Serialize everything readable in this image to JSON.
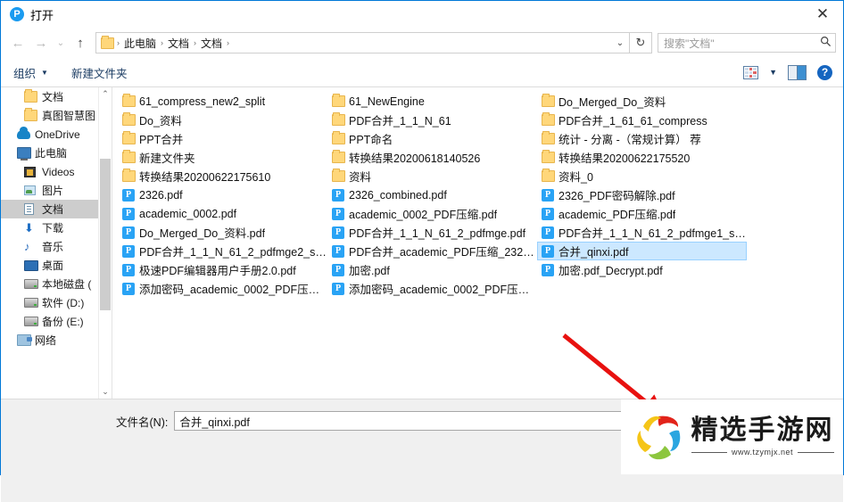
{
  "window": {
    "title": "打开",
    "app_icon": "pdf-app-icon",
    "app_icon_letter": "P",
    "close_label": "✕",
    "border_color": "#0078d7"
  },
  "nav": {
    "back_label": "←",
    "forward_label": "→",
    "history_label": "⌄",
    "up_label": "↑",
    "breadcrumb": [
      "此电脑",
      "文档",
      "文档"
    ],
    "breadcrumb_separator": "›",
    "dropdown_label": "⌄",
    "refresh_label": "↻"
  },
  "search": {
    "placeholder": "搜索\"文档\"",
    "icon": "search-icon"
  },
  "commandbar": {
    "organize_label": "组织",
    "organize_caret": "▼",
    "new_folder_label": "新建文件夹",
    "view_caret": "▼",
    "help_label": "?"
  },
  "sidebar": {
    "items": [
      {
        "label": "文档",
        "icon": "folder-icon",
        "indent": true,
        "selected": false
      },
      {
        "label": "真图智慧图",
        "icon": "folder-icon",
        "indent": true,
        "selected": false
      },
      {
        "label": "OneDrive",
        "icon": "cloud-icon",
        "indent": false,
        "selected": false
      },
      {
        "label": "此电脑",
        "icon": "computer-icon",
        "indent": false,
        "selected": false
      },
      {
        "label": "Videos",
        "icon": "video-icon",
        "indent": true,
        "selected": false
      },
      {
        "label": "图片",
        "icon": "pictures-icon",
        "indent": true,
        "selected": false
      },
      {
        "label": "文档",
        "icon": "documents-icon",
        "indent": true,
        "selected": true
      },
      {
        "label": "下载",
        "icon": "download-icon",
        "indent": true,
        "selected": false
      },
      {
        "label": "音乐",
        "icon": "music-icon",
        "indent": true,
        "selected": false
      },
      {
        "label": "桌面",
        "icon": "desktop-icon",
        "indent": true,
        "selected": false
      },
      {
        "label": "本地磁盘 (",
        "icon": "disk-icon",
        "indent": true,
        "selected": false
      },
      {
        "label": "软件 (D:)",
        "icon": "disk-icon",
        "indent": true,
        "selected": false
      },
      {
        "label": "备份 (E:)",
        "icon": "disk-icon",
        "indent": true,
        "selected": false
      },
      {
        "label": "网络",
        "icon": "network-icon",
        "indent": false,
        "selected": false
      }
    ],
    "scroll_up": "⌃",
    "scroll_down": "⌄"
  },
  "filelist": {
    "columns": [
      [
        {
          "name": "61_compress_new2_split",
          "type": "folder",
          "selected": false
        },
        {
          "name": "Do_资料",
          "type": "folder",
          "selected": false
        },
        {
          "name": "PPT合并",
          "type": "folder",
          "selected": false
        },
        {
          "name": "新建文件夹",
          "type": "folder",
          "selected": false
        },
        {
          "name": "转换结果20200622175610",
          "type": "folder",
          "selected": false
        },
        {
          "name": "2326.pdf",
          "type": "pdf",
          "selected": false
        },
        {
          "name": "academic_0002.pdf",
          "type": "pdf",
          "selected": false
        },
        {
          "name": "Do_Merged_Do_资料.pdf",
          "type": "pdf",
          "selected": false
        },
        {
          "name": "PDF合并_1_1_N_61_2_pdfmge2_sp...",
          "type": "pdf",
          "selected": false
        },
        {
          "name": "极速PDF编辑器用户手册2.0.pdf",
          "type": "pdf",
          "selected": false
        },
        {
          "name": "添加密码_academic_0002_PDF压缩...",
          "type": "pdf",
          "selected": false
        }
      ],
      [
        {
          "name": "61_NewEngine",
          "type": "folder",
          "selected": false
        },
        {
          "name": "PDF合并_1_1_N_61",
          "type": "folder",
          "selected": false
        },
        {
          "name": "PPT命名",
          "type": "folder",
          "selected": false
        },
        {
          "name": "转换结果20200618140526",
          "type": "folder",
          "selected": false
        },
        {
          "name": "资料",
          "type": "folder",
          "selected": false
        },
        {
          "name": "2326_combined.pdf",
          "type": "pdf",
          "selected": false
        },
        {
          "name": "academic_0002_PDF压缩.pdf",
          "type": "pdf",
          "selected": false
        },
        {
          "name": "PDF合并_1_1_N_61_2_pdfmge.pdf",
          "type": "pdf",
          "selected": false
        },
        {
          "name": "PDF合并_academic_PDF压缩_2326....",
          "type": "pdf",
          "selected": false
        },
        {
          "name": "加密.pdf",
          "type": "pdf",
          "selected": false
        },
        {
          "name": "添加密码_academic_0002_PDF压缩...",
          "type": "pdf",
          "selected": false
        }
      ],
      [
        {
          "name": "Do_Merged_Do_资料",
          "type": "folder",
          "selected": false
        },
        {
          "name": "PDF合并_1_61_61_compress",
          "type": "folder",
          "selected": false
        },
        {
          "name": "统计 - 分离 -（常规计算） 荐",
          "type": "folder",
          "selected": false
        },
        {
          "name": "转换结果20200622175520",
          "type": "folder",
          "selected": false
        },
        {
          "name": "资料_0",
          "type": "folder",
          "selected": false
        },
        {
          "name": "2326_PDF密码解除.pdf",
          "type": "pdf",
          "selected": false
        },
        {
          "name": "academic_PDF压缩.pdf",
          "type": "pdf",
          "selected": false
        },
        {
          "name": "PDF合并_1_1_N_61_2_pdfmge1_sp...",
          "type": "pdf",
          "selected": false
        },
        {
          "name": "合并_qinxi.pdf",
          "type": "pdf",
          "selected": true
        },
        {
          "name": "加密.pdf_Decrypt.pdf",
          "type": "pdf",
          "selected": false
        }
      ]
    ],
    "selection_color": "#cce8ff"
  },
  "bottom": {
    "filename_label": "文件名(N):",
    "filename_value": "合并_qinxi.pdf"
  },
  "annotations": {
    "arrow_color": "#e8110f",
    "watermark_title": "精选手游网",
    "watermark_url": "www.tzymjx.net"
  }
}
